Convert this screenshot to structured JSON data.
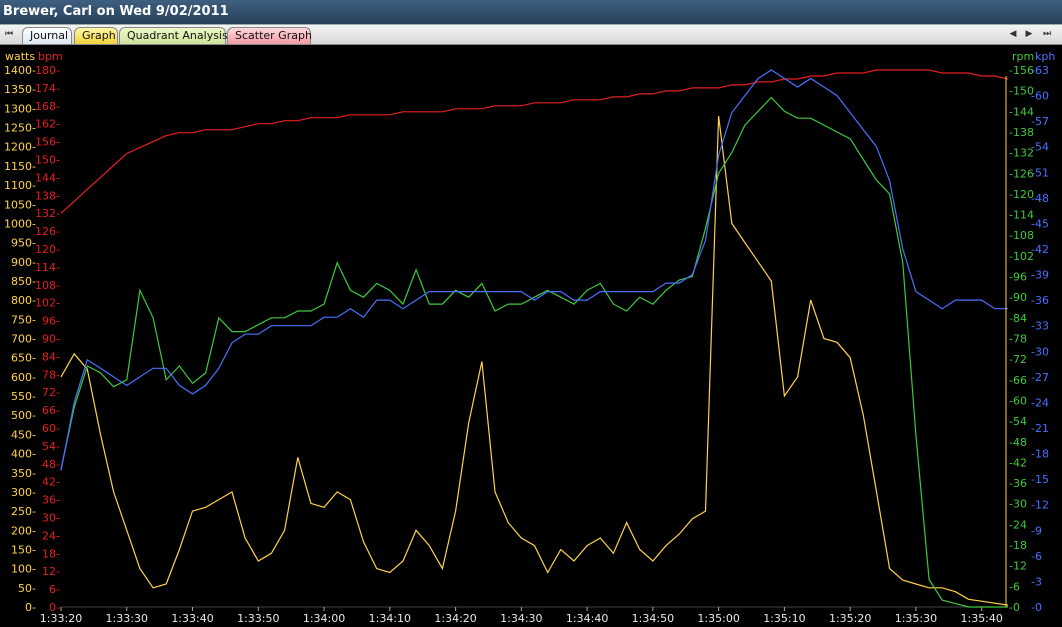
{
  "window": {
    "title": "Brewer, Carl on Wed 9/02/2011"
  },
  "tabs": [
    {
      "label": "Journal",
      "active": false
    },
    {
      "label": "Graph",
      "active": true
    },
    {
      "label": "Quadrant Analysis",
      "active": false
    },
    {
      "label": "Scatter Graph",
      "active": false
    }
  ],
  "nav_icons": [
    "first-icon",
    "prev-icon",
    "next-icon",
    "last-icon"
  ],
  "axes": {
    "watts": {
      "label": "watts",
      "color": "#ffd24a",
      "min": 0,
      "max": 1400,
      "step": 50
    },
    "bpm": {
      "label": "bpm",
      "color": "#e32020",
      "min": 0,
      "max": 180,
      "step": 6
    },
    "rpm": {
      "label": "rpm",
      "color": "#3ec83e",
      "min": 0,
      "max": 156,
      "step": 6
    },
    "kph": {
      "label": "kph",
      "color": "#4a70ff",
      "min": 0,
      "max": 63,
      "step": 3
    },
    "time": {
      "labels": [
        "1:33:20",
        "1:33:30",
        "1:33:40",
        "1:33:50",
        "1:34:00",
        "1:34:10",
        "1:34:20",
        "1:34:30",
        "1:34:40",
        "1:34:50",
        "1:35:00",
        "1:35:10",
        "1:35:20",
        "1:35:30",
        "1:35:40"
      ],
      "min": 0,
      "max": 144
    }
  },
  "chart_data": {
    "type": "line",
    "x_unit": "seconds from 1:33:20",
    "x": [
      0,
      2,
      4,
      6,
      8,
      10,
      12,
      14,
      16,
      18,
      20,
      22,
      24,
      26,
      28,
      30,
      32,
      34,
      36,
      38,
      40,
      42,
      44,
      46,
      48,
      50,
      52,
      54,
      56,
      58,
      60,
      62,
      64,
      66,
      68,
      70,
      72,
      74,
      76,
      78,
      80,
      82,
      84,
      86,
      88,
      90,
      92,
      94,
      96,
      98,
      100,
      102,
      104,
      106,
      108,
      110,
      112,
      114,
      116,
      118,
      120,
      122,
      124,
      126,
      128,
      130,
      132,
      134,
      136,
      138,
      140,
      142,
      144
    ],
    "series": [
      {
        "name": "watts",
        "color": "#ffd24a",
        "values": [
          600,
          660,
          620,
          450,
          300,
          200,
          100,
          50,
          60,
          150,
          250,
          260,
          280,
          300,
          180,
          120,
          140,
          200,
          390,
          270,
          260,
          300,
          280,
          170,
          100,
          90,
          120,
          200,
          160,
          100,
          250,
          480,
          640,
          300,
          220,
          180,
          160,
          90,
          150,
          120,
          160,
          180,
          140,
          220,
          150,
          120,
          160,
          190,
          230,
          250,
          1280,
          1000,
          950,
          900,
          850,
          550,
          600,
          800,
          700,
          690,
          650,
          500,
          300,
          100,
          70,
          60,
          50,
          50,
          40,
          20,
          15,
          10,
          5
        ]
      },
      {
        "name": "bpm",
        "color": "#e32020",
        "values": [
          132,
          136,
          140,
          144,
          148,
          152,
          154,
          156,
          158,
          159,
          159,
          160,
          160,
          160,
          161,
          162,
          162,
          163,
          163,
          164,
          164,
          164,
          165,
          165,
          165,
          165,
          166,
          166,
          166,
          166,
          167,
          167,
          167,
          168,
          168,
          168,
          169,
          169,
          169,
          170,
          170,
          170,
          171,
          171,
          172,
          172,
          173,
          173,
          174,
          174,
          174,
          175,
          175,
          176,
          176,
          177,
          177,
          178,
          178,
          179,
          179,
          179,
          180,
          180,
          180,
          180,
          180,
          179,
          179,
          179,
          178,
          178,
          177
        ]
      },
      {
        "name": "rpm",
        "color": "#3ec83e",
        "values": [
          40,
          58,
          70,
          68,
          64,
          66,
          92,
          84,
          66,
          70,
          65,
          68,
          84,
          80,
          80,
          82,
          84,
          84,
          86,
          86,
          88,
          100,
          92,
          90,
          94,
          92,
          88,
          98,
          88,
          88,
          92,
          90,
          94,
          86,
          88,
          88,
          90,
          92,
          90,
          88,
          92,
          94,
          88,
          86,
          90,
          88,
          92,
          95,
          96,
          110,
          126,
          132,
          140,
          144,
          148,
          144,
          142,
          142,
          140,
          138,
          136,
          130,
          124,
          120,
          100,
          50,
          8,
          2,
          1,
          0,
          0,
          0,
          0
        ]
      },
      {
        "name": "kph",
        "color": "#4a70ff",
        "values": [
          16,
          24,
          29,
          28,
          27,
          26,
          27,
          28,
          28,
          26,
          25,
          26,
          28,
          31,
          32,
          32,
          33,
          33,
          33,
          33,
          34,
          34,
          35,
          34,
          36,
          36,
          35,
          36,
          37,
          37,
          37,
          37,
          37,
          37,
          37,
          37,
          36,
          37,
          37,
          36,
          36,
          37,
          37,
          37,
          37,
          37,
          38,
          38,
          39,
          43,
          53,
          58,
          60,
          62,
          63,
          62,
          61,
          62,
          61,
          60,
          58,
          56,
          54,
          50,
          42,
          37,
          36,
          35,
          36,
          36,
          36,
          35,
          35
        ]
      }
    ]
  }
}
